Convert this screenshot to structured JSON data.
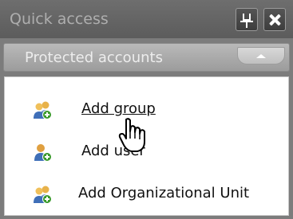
{
  "panel": {
    "title": "Quick access",
    "icons": {
      "pin": "pin-icon",
      "close": "close-icon"
    }
  },
  "section": {
    "title": "Protected accounts",
    "collapse_icon": "chevron-up-icon"
  },
  "items": [
    {
      "label": "Add group",
      "icon": "group-add-icon",
      "hovered": true
    },
    {
      "label": "Add user",
      "icon": "user-add-icon",
      "hovered": false
    },
    {
      "label": "Add Organizational Unit",
      "icon": "ou-add-icon",
      "hovered": false
    }
  ],
  "cursor": "hand-pointer-cursor",
  "colors": {
    "title_bar": "#5f5f5f",
    "section_header": "#a9a9a9",
    "panel_bg": "#ffffff",
    "add_badge": "#3a9a2c"
  }
}
